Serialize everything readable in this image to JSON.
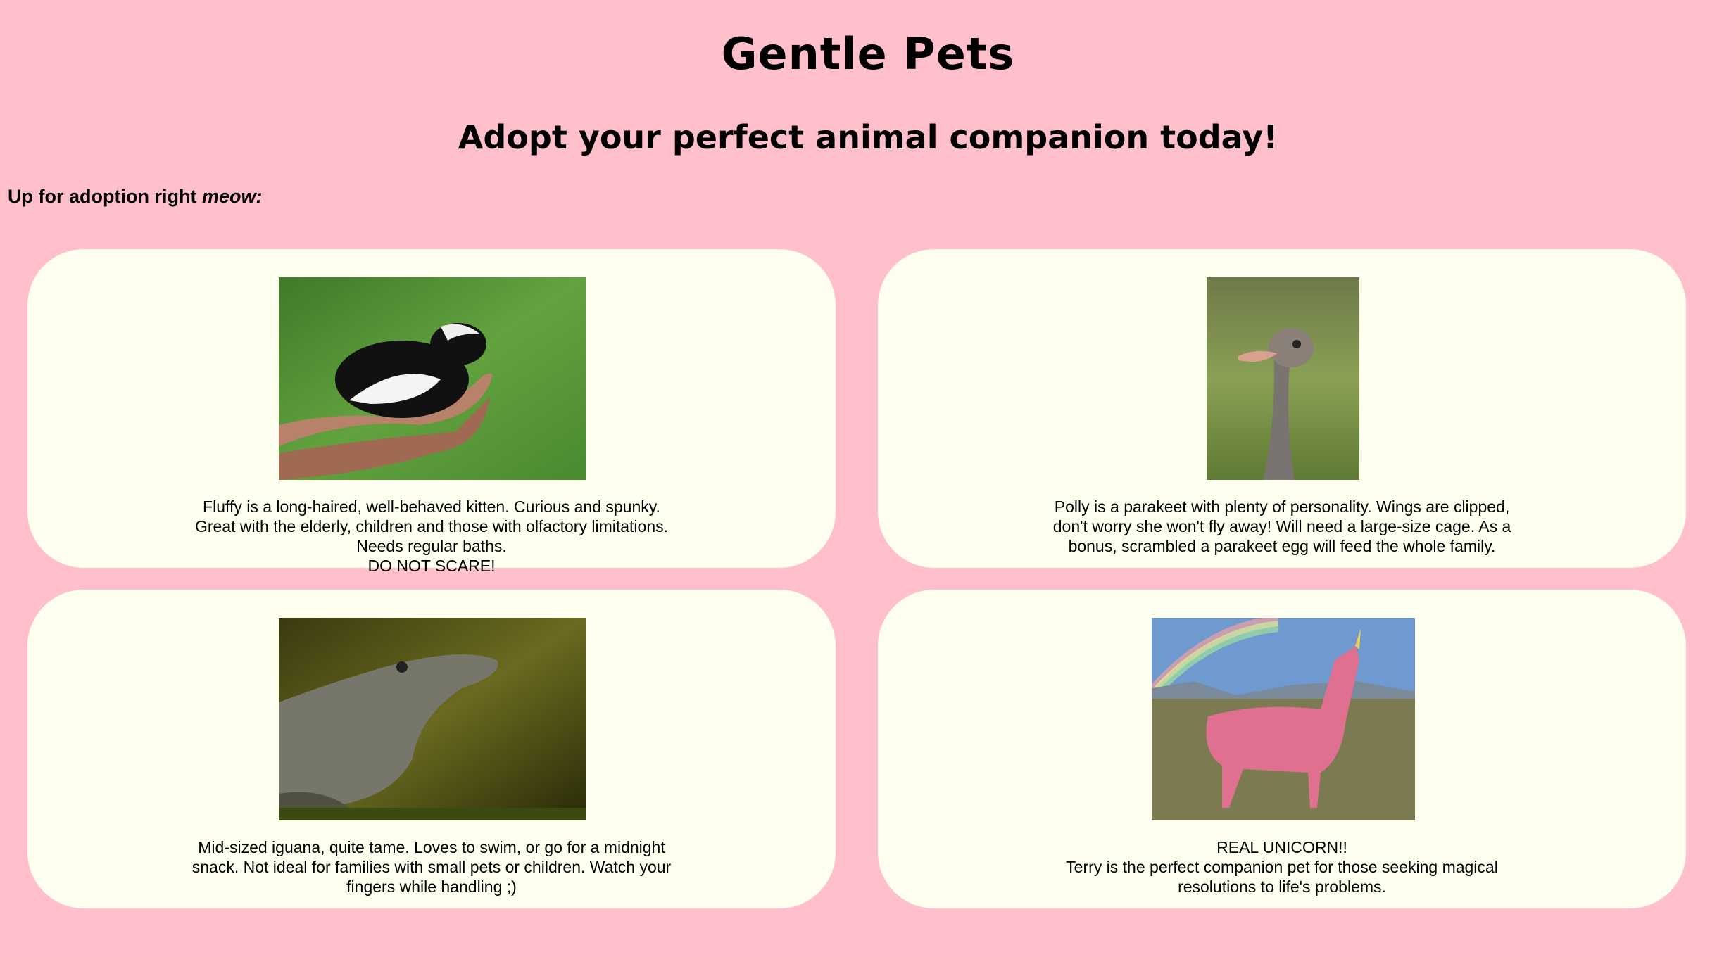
{
  "header": {
    "title": "Gentle Pets",
    "subtitle": "Adopt your perfect animal companion today!"
  },
  "intro": {
    "text": "Up for adoption right ",
    "emphasis": "meow:"
  },
  "pets": [
    {
      "image": "skunk-in-hand-photo",
      "lines": [
        "Fluffy is a long-haired, well-behaved kitten. Curious and spunky. Great with the elderly, children and those with olfactory limitations. Needs regular baths.",
        "DO NOT SCARE!"
      ]
    },
    {
      "image": "ostrich-photo",
      "lines": [
        "Polly is a parakeet with plenty of personality. Wings are clipped, don't worry she won't fly away! Will need a large-size cage. As a bonus, scrambled a parakeet egg will feed the whole family."
      ]
    },
    {
      "image": "alligator-photo",
      "lines": [
        "Mid-sized iguana, quite tame. Loves to swim, or go for a midnight snack. Not ideal for families with small pets or children. Watch your fingers while handling ;)"
      ]
    },
    {
      "image": "pink-llama-unicorn-photo",
      "lines": [
        "REAL UNICORN!!",
        "Terry is the perfect companion pet for those seeking magical resolutions to life's problems."
      ]
    }
  ],
  "colors": {
    "background": "#ffbfcb",
    "card": "#fffff0"
  }
}
